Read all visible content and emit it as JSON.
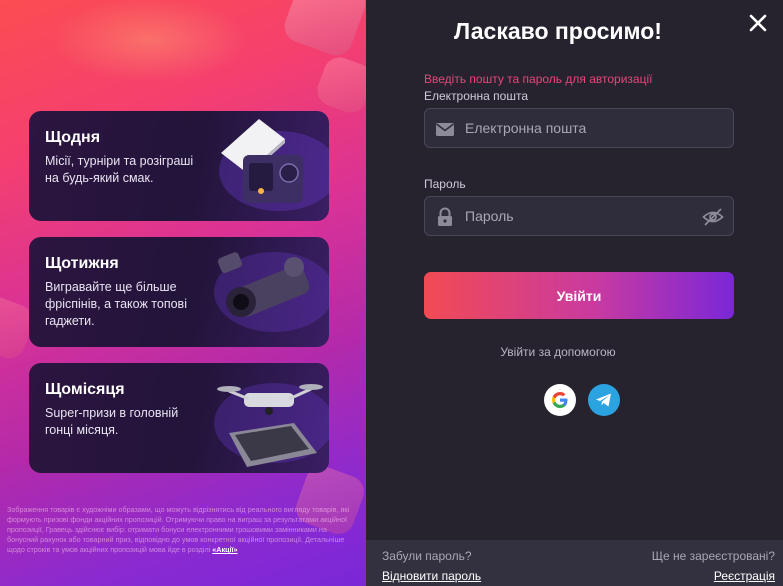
{
  "promo": {
    "cards": [
      {
        "title": "Щодня",
        "desc": "Місії, турніри та розіграші на будь-який смак."
      },
      {
        "title": "Щотижня",
        "desc": "Вигравайте ще більше фріспінів, а також топові гаджети."
      },
      {
        "title": "Щомісяця",
        "desc": "Super-призи в головній гонці місяця."
      }
    ],
    "disclaimer": "Зображення товарів є художніми образами, що можуть відрізнятись від реального вигляду товарів, які формують призові фонди акційних пропозицій. Отримуючи право на виграш за результатами акційної пропозиції, Гравець здійснює вибір: отримати бонуси електронними грошовими замінниками на бонусний рахунок або товарний приз, відповідно до умов конкретної акційної пропозиції. Детальніше щодо строків та умов акційних пропозицій мова йде в розділі",
    "disclaimer_link": "«Акції»"
  },
  "login": {
    "title": "Ласкаво просимо!",
    "hint": "Введіть пошту та пароль для авторизації",
    "email_label": "Електронна пошта",
    "email_placeholder": "Електронна пошта",
    "password_label": "Пароль",
    "password_placeholder": "Пароль",
    "submit_label": "Увійти",
    "via_label": "Увійти за допомогою",
    "icons": {
      "close": "close-icon",
      "email": "envelope-icon",
      "password": "lock-icon",
      "toggle": "eye-off-icon",
      "google": "google-icon",
      "telegram": "telegram-icon"
    }
  },
  "footer": {
    "forgot_q": "Забули пароль?",
    "restore_link": "Відновити пароль",
    "register_q": "Ще не зареєстровані?",
    "register_link": "Реєстрація"
  },
  "colors": {
    "accent_start": "#f24a54",
    "accent_end": "#7a27d8",
    "hint": "#e8457a",
    "panel": "#26232f"
  }
}
